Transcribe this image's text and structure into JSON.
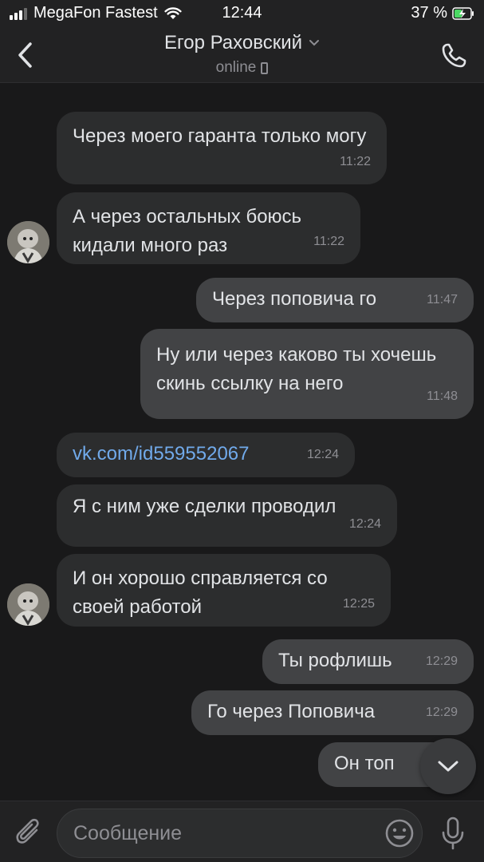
{
  "status_bar": {
    "carrier": "MegaFon Fastest",
    "time": "12:44",
    "battery": "37 %"
  },
  "header": {
    "contact_name": "Егор Раховский",
    "status": "online"
  },
  "messages": [
    {
      "direction": "in",
      "text": "Через моего гаранта только могу",
      "time": "11:22"
    },
    {
      "direction": "in",
      "text": "А через остальных боюсь кидали много раз",
      "time": "11:22"
    },
    {
      "direction": "out",
      "text": "Через поповича го",
      "time": "11:47"
    },
    {
      "direction": "out",
      "text": "Ну или через каково ты хочешь скинь ссылку на него",
      "time": "11:48"
    },
    {
      "direction": "in",
      "text": "vk.com/id559552067",
      "time": "12:24"
    },
    {
      "direction": "in",
      "text": "Я с ним уже сделки проводил",
      "time": "12:24"
    },
    {
      "direction": "in",
      "text": "И он хорошо справляется со своей работой",
      "time": "12:25"
    },
    {
      "direction": "out",
      "text": "Ты рофлишь",
      "time": "12:29"
    },
    {
      "direction": "out",
      "text": "Го через Поповича",
      "time": "12:29"
    },
    {
      "direction": "out",
      "text": "Он топ",
      "time": ""
    }
  ],
  "composer": {
    "placeholder": "Сообщение"
  },
  "colors": {
    "background": "#19191a",
    "incoming_bubble": "#2c2d2e",
    "outgoing_bubble": "#424345",
    "link": "#71aaeb"
  }
}
